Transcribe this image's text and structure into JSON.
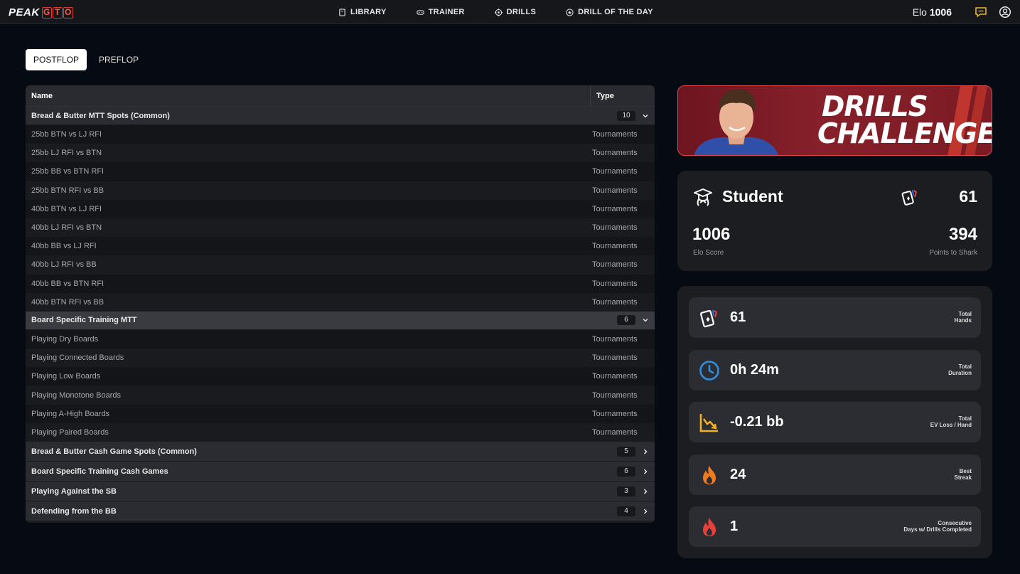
{
  "brand": {
    "peak": "PEAK",
    "gto": [
      "G",
      "T",
      "O"
    ]
  },
  "nav": [
    {
      "label": "LIBRARY",
      "icon": "book-icon"
    },
    {
      "label": "TRAINER",
      "icon": "gamepad-icon"
    },
    {
      "label": "DRILLS",
      "icon": "target-icon"
    },
    {
      "label": "DRILL OF THE DAY",
      "icon": "star-circle-icon"
    }
  ],
  "header": {
    "elo_label": "Elo",
    "elo_value": "1006"
  },
  "tabs": [
    {
      "label": "POSTFLOP",
      "active": true
    },
    {
      "label": "PREFLOP",
      "active": false
    }
  ],
  "table": {
    "col_name": "Name",
    "col_type": "Type",
    "groups": [
      {
        "name": "Bread & Butter MTT Spots (Common)",
        "count": "10",
        "expanded": true,
        "rows": [
          {
            "name": "25bb BTN vs LJ RFI",
            "type": "Tournaments"
          },
          {
            "name": "25bb LJ RFI vs BTN",
            "type": "Tournaments"
          },
          {
            "name": "25bb BB vs BTN RFI",
            "type": "Tournaments"
          },
          {
            "name": "25bb BTN RFI vs BB",
            "type": "Tournaments"
          },
          {
            "name": "40bb BTN vs LJ RFI",
            "type": "Tournaments"
          },
          {
            "name": "40bb LJ RFI vs BTN",
            "type": "Tournaments"
          },
          {
            "name": "40bb BB vs LJ RFI",
            "type": "Tournaments"
          },
          {
            "name": "40bb LJ RFI vs BB",
            "type": "Tournaments"
          },
          {
            "name": "40bb BB vs BTN RFI",
            "type": "Tournaments"
          },
          {
            "name": "40bb BTN RFI vs BB",
            "type": "Tournaments"
          }
        ]
      },
      {
        "name": "Board Specific Training MTT",
        "count": "6",
        "expanded": true,
        "rows": [
          {
            "name": "Playing Dry Boards",
            "type": "Tournaments"
          },
          {
            "name": "Playing Connected Boards",
            "type": "Tournaments"
          },
          {
            "name": "Playing Low Boards",
            "type": "Tournaments"
          },
          {
            "name": "Playing Monotone Boards",
            "type": "Tournaments"
          },
          {
            "name": "Playing A-High Boards",
            "type": "Tournaments"
          },
          {
            "name": "Playing Paired Boards",
            "type": "Tournaments"
          }
        ]
      },
      {
        "name": "Bread & Butter Cash Game Spots (Common)",
        "count": "5",
        "expanded": false,
        "rows": []
      },
      {
        "name": "Board Specific Training Cash Games",
        "count": "6",
        "expanded": false,
        "rows": []
      },
      {
        "name": "Playing Against the SB",
        "count": "3",
        "expanded": false,
        "rows": []
      },
      {
        "name": "Defending from the BB",
        "count": "4",
        "expanded": false,
        "rows": []
      }
    ]
  },
  "banner": {
    "line1": "DRILLS",
    "line2": "CHALLENGE"
  },
  "profile": {
    "rank": "Student",
    "hands": "61",
    "elo": "1006",
    "elo_label": "Elo Score",
    "points": "394",
    "points_label": "Points to Shark"
  },
  "stats": [
    {
      "value": "61",
      "label1": "Total",
      "label2": "Hands",
      "icon": "cards-icon",
      "color": "#ffffff"
    },
    {
      "value": "0h 24m",
      "label1": "Total",
      "label2": "Duration",
      "icon": "clock-icon",
      "color": "#2f8fe0"
    },
    {
      "value": "-0.21 bb",
      "label1": "Total",
      "label2": "EV Loss / Hand",
      "icon": "chart-down-icon",
      "color": "#f0b020"
    },
    {
      "value": "24",
      "label1": "Best",
      "label2": "Streak",
      "icon": "flame-orange-icon",
      "color": "#f07a20"
    },
    {
      "value": "1",
      "label1": "Consecutive",
      "label2": "Days w/ Drills Completed",
      "icon": "flame-red-icon",
      "color": "#e8403a"
    }
  ]
}
